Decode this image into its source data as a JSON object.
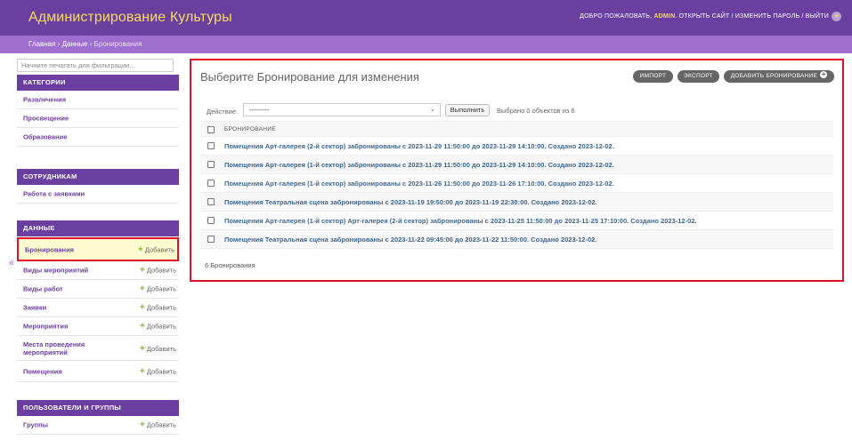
{
  "header": {
    "site_title": "Администрирование Культуры",
    "welcome": "ДОБРО ПОЖАЛОВАТЬ,",
    "username": "ADMIN",
    "view_site": "ОТКРЫТЬ САЙТ",
    "change_password": "ИЗМЕНИТЬ ПАРОЛЬ",
    "logout": "ВЫЙТИ",
    "separator": "/",
    "theme_icon": "sun-icon"
  },
  "breadcrumbs": {
    "home": "Главная",
    "app": "Данные",
    "current": "Бронирования",
    "sep": "›"
  },
  "sidebar": {
    "filter_placeholder": "Начните печатать для фильтрации...",
    "modules": [
      {
        "caption": "КАТЕГОРИИ",
        "items": [
          {
            "label": "Развлечения"
          },
          {
            "label": "Просвещение"
          },
          {
            "label": "Образование"
          }
        ]
      },
      {
        "caption": "СОТРУДНИКАМ",
        "items": [
          {
            "label": "Работа с заявками"
          }
        ]
      },
      {
        "caption": "ДАННЫЕ",
        "items": [
          {
            "label": "Бронирования",
            "add": "Добавить",
            "current": true
          },
          {
            "label": "Виды мероприятий",
            "add": "Добавить"
          },
          {
            "label": "Виды работ",
            "add": "Добавить"
          },
          {
            "label": "Заявки",
            "add": "Добавить"
          },
          {
            "label": "Мероприятия",
            "add": "Добавить"
          },
          {
            "label": "Места проведения мероприятий",
            "add": "Добавить"
          },
          {
            "label": "Помещения",
            "add": "Добавить"
          }
        ]
      },
      {
        "caption": "ПОЛЬЗОВАТЕЛИ И ГРУППЫ",
        "items": [
          {
            "label": "Группы",
            "add": "Добавить"
          }
        ]
      }
    ],
    "collapse_icon": "«"
  },
  "main": {
    "title": "Выберите Бронирование для изменения",
    "tools": {
      "import": "ИМПОРТ",
      "export": "ЭКСПОРТ",
      "add": "ДОБАВИТЬ БРОНИРОВАНИЕ"
    },
    "actions": {
      "label": "Действие:",
      "selected": "---------",
      "go": "Выполнить",
      "counter": "Выбрано 0 объектов из 6"
    },
    "column_header": "БРОНИРОВАНИЕ",
    "rows": [
      "Помещения Арт-галерея (2-й сектор) забронированы с 2023-11-29 11:50:00 до 2023-11-29 14:10:00. Создано 2023-12-02.",
      "Помещения Арт-галерея (1-й сектор) забронированы с 2023-11-29 11:50:00 до 2023-11-29 14:10:00. Создано 2023-12-02.",
      "Помещения Арт-галерея (1-й сектор) забронированы с 2023-11-26 11:50:00 до 2023-11-26 17:10:00. Создано 2023-12-02.",
      "Помещения Театральная сцена забронированы с 2023-11-19 19:50:00 до 2023-11-19 22:30:00. Создано 2023-12-02.",
      "Помещения Арт-галерея (1-й сектор) Арт-галерея (2-й сектор) забронированы с 2023-11-25 11:50:00 до 2023-11-25 17:10:00. Создано 2023-12-02.",
      "Помещения Театральная сцена забронированы с 2023-11-22 09:45:00 до 2023-11-22 11:50:00. Создано 2023-12-02."
    ],
    "paginator": "6 Бронирования"
  }
}
